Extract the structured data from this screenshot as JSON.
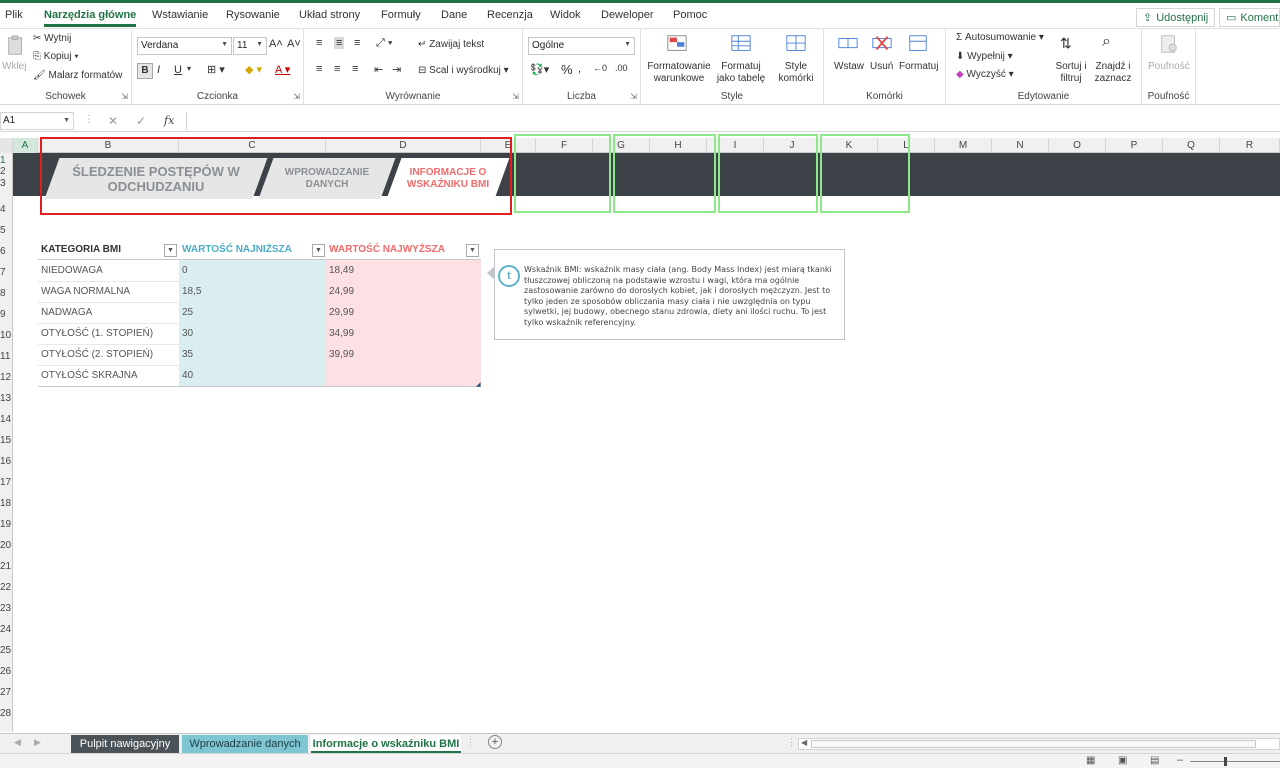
{
  "ribbon_tabs": [
    "Plik",
    "Narzędzia główne",
    "Wstawianie",
    "Rysowanie",
    "Układ strony",
    "Formuły",
    "Dane",
    "Recenzja",
    "Widok",
    "Deweloper",
    "Pomoc"
  ],
  "share_label": "Udostępnij",
  "comments_label": "Komentarze",
  "clipboard": {
    "paste": "Wklej",
    "cut": "Wytnij",
    "copy": "Kopiuj",
    "format_painter": "Malarz formatów",
    "group": "Schowek"
  },
  "font": {
    "name": "Verdana",
    "size": "11",
    "bold": "B",
    "italic": "I",
    "underline": "U",
    "group": "Czcionka"
  },
  "alignment": {
    "wrap": "Zawijaj tekst",
    "merge": "Scal i wyśrodkuj",
    "group": "Wyrównanie"
  },
  "number": {
    "format": "Ogólne",
    "group": "Liczba"
  },
  "styles": {
    "conditional": "Formatowanie warunkowe",
    "table": "Formatuj jako tabelę",
    "cell": "Style komórki",
    "group": "Style"
  },
  "cells": {
    "insert": "Wstaw",
    "delete": "Usuń",
    "format": "Formatuj",
    "group": "Komórki"
  },
  "editing": {
    "autosum": "Autosumowanie",
    "fill": "Wypełnij",
    "clear": "Wyczyść",
    "sort": "Sortuj i filtruj",
    "find": "Znajdź i zaznacz",
    "group": "Edytowanie"
  },
  "sensitivity": {
    "label": "Poufność",
    "group": "Poufność"
  },
  "name_box": "A1",
  "fx": "fx",
  "columns": [
    "A",
    "B",
    "C",
    "D",
    "E",
    "F",
    "G",
    "H",
    "I",
    "J",
    "K",
    "L",
    "M",
    "N",
    "O",
    "P",
    "Q",
    "R"
  ],
  "rows": [
    "1",
    "2",
    "3",
    "4",
    "5",
    "6",
    "7",
    "8",
    "9",
    "10",
    "11",
    "12",
    "13",
    "14",
    "15",
    "16",
    "17",
    "18",
    "19",
    "20",
    "21",
    "22",
    "23",
    "24",
    "25",
    "26",
    "27",
    "28"
  ],
  "nav": {
    "tab1": "ŚLEDZENIE POSTĘPÓW W ODCHUDZANIU",
    "tab2": "WPROWADZANIE DANYCH",
    "tab3": "INFORMACJE O WSKAŹNIKU BMI"
  },
  "table": {
    "headers": [
      "KATEGORIA BMI",
      "WARTOŚĆ NAJNIŻSZA",
      "WARTOŚĆ NAJWYŻSZA"
    ],
    "rows": [
      [
        "NIEDOWAGA",
        "0",
        "18,49"
      ],
      [
        "WAGA NORMALNA",
        "18,5",
        "24,99"
      ],
      [
        "NADWAGA",
        "25",
        "29,99"
      ],
      [
        "OTYŁOŚĆ (1. STOPIEŃ)",
        "30",
        "34,99"
      ],
      [
        "OTYŁOŚĆ (2. STOPIEŃ)",
        "35",
        "39,99"
      ],
      [
        "OTYŁOŚĆ SKRAJNA",
        "40",
        ""
      ]
    ]
  },
  "info_text": "Wskaźnik BMI: wskaźnik masy ciała (ang. Body Mass Index) jest miarą tkanki tłuszczowej obliczoną na podstawie wzrostu i wagi, która ma ogólnie zastosowanie zarówno do dorosłych kobiet, jak i dorosłych mężczyzn. Jest to tylko jeden ze sposobów obliczania masy ciała i nie uwzględnia on typu sylwetki, jej budowy, obecnego stanu zdrowia, diety ani ilości ruchu. To jest tylko wskaźnik referencyjny.",
  "info_badge": "t",
  "sheet_tabs": [
    "Pulpit nawigacyjny",
    "Wprowadzanie danych",
    "Informacje o wskaźniku BMI"
  ],
  "colors": {
    "accent": "#217346",
    "banner": "#3c4248",
    "blue_header": "#4bacc6",
    "red_header": "#f26b6b",
    "highlight_red": "#e02020",
    "highlight_green": "#8ee88a"
  }
}
